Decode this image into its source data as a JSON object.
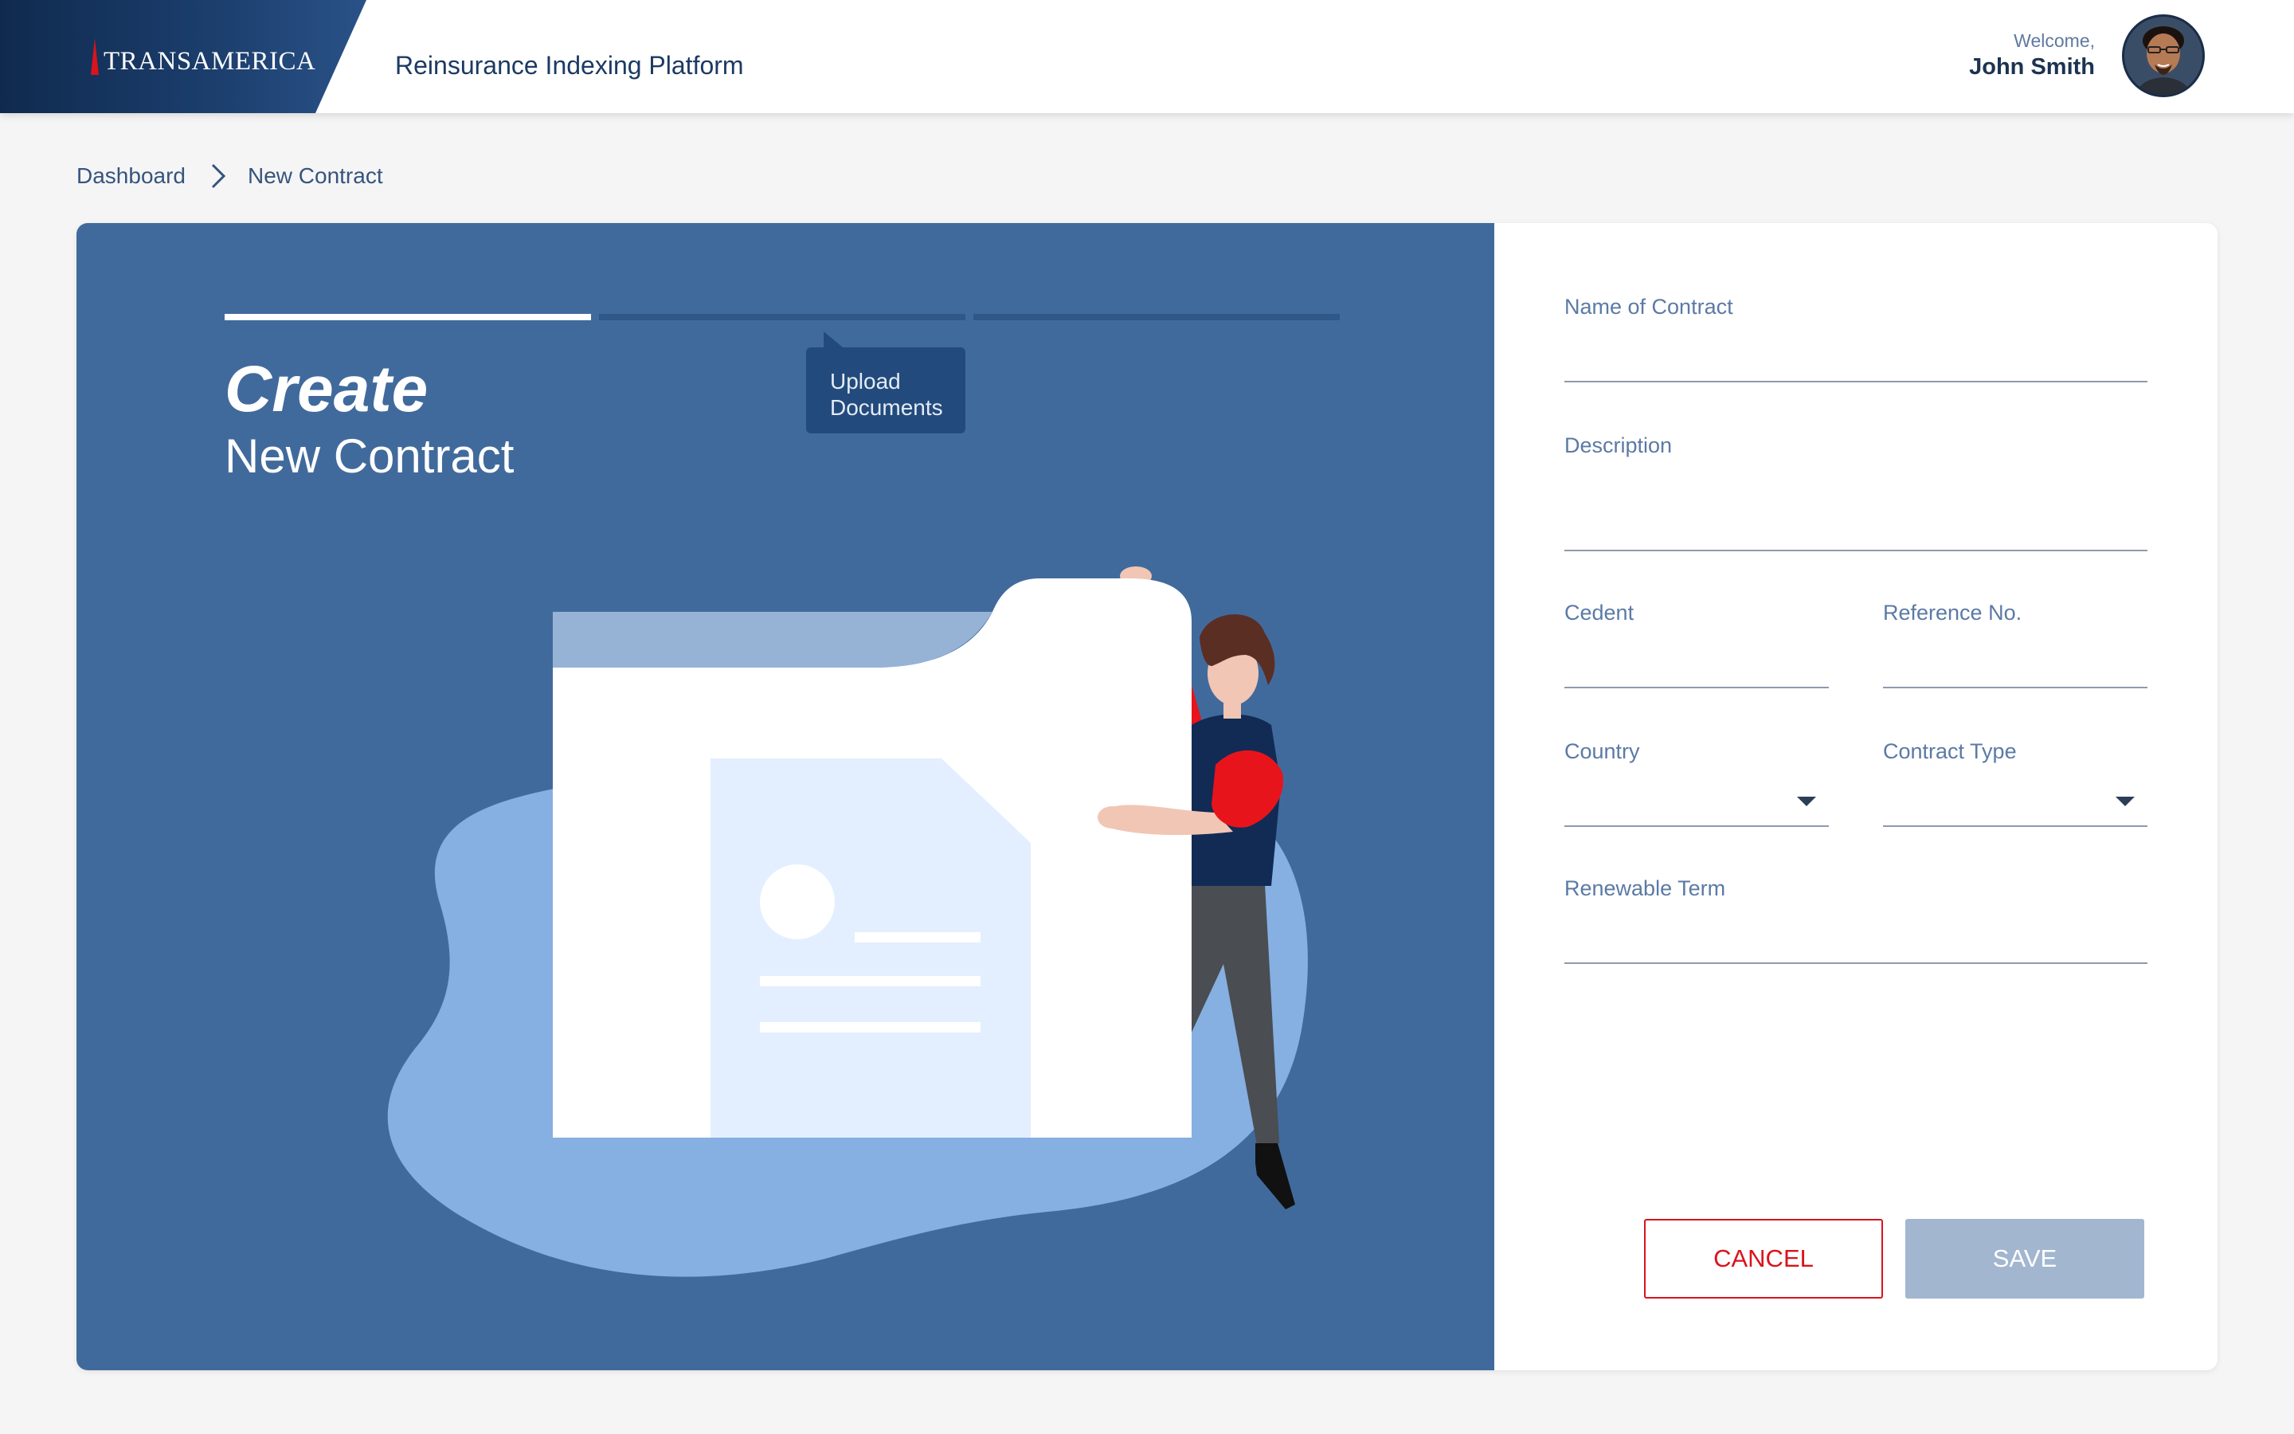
{
  "header": {
    "logo_text": "TRANSAMERICA",
    "app_title": "Reinsurance Indexing Platform",
    "welcome_label": "Welcome,",
    "user_name": "John Smith"
  },
  "breadcrumb": {
    "items": [
      "Dashboard",
      "New Contract"
    ]
  },
  "wizard": {
    "title": "Create",
    "subtitle": "New Contract",
    "steps_total": 3,
    "current_step": 1,
    "tooltip": "Upload Documents"
  },
  "form": {
    "name_label": "Name of Contract",
    "name_value": "",
    "description_label": "Description",
    "description_value": "",
    "cedent_label": "Cedent",
    "cedent_value": "",
    "reference_label": "Reference No.",
    "reference_value": "",
    "country_label": "Country",
    "country_value": "",
    "contract_type_label": "Contract Type",
    "contract_type_value": "",
    "renewable_label": "Renewable Term",
    "renewable_value": ""
  },
  "buttons": {
    "cancel": "CANCEL",
    "save": "SAVE"
  },
  "colors": {
    "brand_navy": "#0f2a4e",
    "panel_blue": "#416a9c",
    "accent_red": "#d9141c",
    "disabled_save": "#a2b6d0"
  }
}
